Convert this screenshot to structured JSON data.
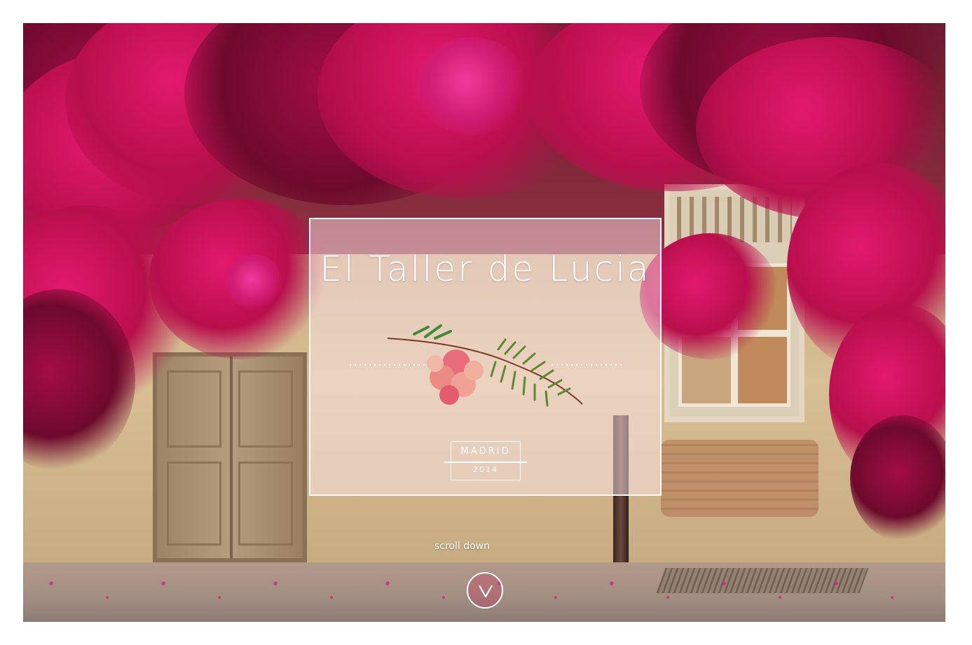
{
  "hero": {
    "title": "El Taller de Lucia",
    "badge": {
      "city": "MADRID",
      "year": "2014"
    },
    "scroll_label": "scroll down",
    "scroll_icon": "chevron-down-icon",
    "colors": {
      "card_border": "#ffffff",
      "card_tint": "#ffe8ee",
      "accent": "#d1145a"
    }
  }
}
